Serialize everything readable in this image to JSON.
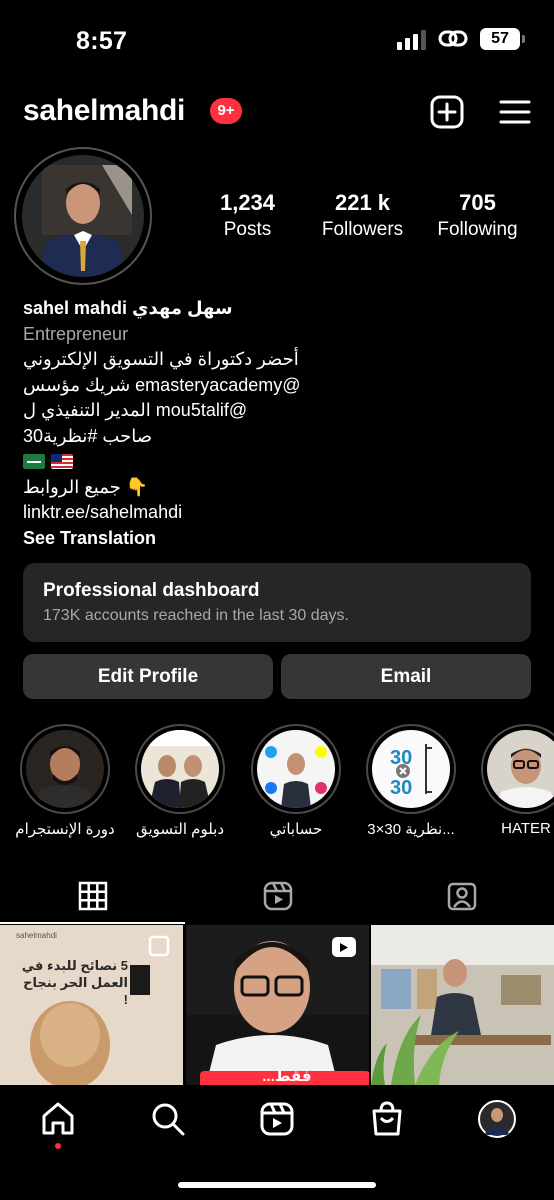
{
  "status_bar": {
    "time": "8:57",
    "battery_level": "57",
    "icons": [
      "signal-icon",
      "link-icon",
      "battery-icon"
    ]
  },
  "header": {
    "username": "sahelmahdi",
    "notification_badge": "9+",
    "icons": [
      "plus-square-icon",
      "hamburger-menu-icon"
    ]
  },
  "stats": [
    {
      "value": "1,234",
      "label": "Posts"
    },
    {
      "value": "221 k",
      "label": "Followers"
    },
    {
      "value": "705",
      "label": "Following"
    }
  ],
  "bio": {
    "name": "sahel mahdi سهل مهدي",
    "category": "Entrepreneur",
    "lines": [
      "أحضر دكتوراة في التسويق الإلكتروني",
      "شريك مؤسس emasteryacademy@",
      "المدير التنفيذي ل mou5talif@",
      "صاحب #نظرية30",
      "جميع الروابط 👇"
    ],
    "link": "linktr.ee/sahelmahdi",
    "see_translation": "See Translation"
  },
  "dashboard": {
    "title": "Professional dashboard",
    "subtitle": "173K accounts reached in the last 30 days."
  },
  "buttons": {
    "edit_profile": "Edit Profile",
    "email": "Email"
  },
  "highlights": [
    {
      "label": "دورة الإنستجرام"
    },
    {
      "label": "دبلوم التسويق"
    },
    {
      "label": "حساباتي"
    },
    {
      "label": "نظرية 30×3..."
    },
    {
      "label": "HATER"
    }
  ],
  "tabs": [
    "grid-icon",
    "reels-icon",
    "tagged-icon"
  ],
  "posts": [
    {
      "overlay_text": "5 نصائح للبدء في العمل الحر بنجاح !",
      "brand": "sahelmahdi"
    },
    {
      "overlay_text": "...فقط"
    },
    {
      "overlay_text": ""
    }
  ],
  "bottom_nav": [
    "home-icon",
    "search-icon",
    "reels-icon",
    "shop-icon",
    "profile-avatar"
  ],
  "colors": {
    "accent_red": "#ff3040",
    "card_bg": "#262626",
    "button_bg": "#363636",
    "muted_text": "#a8a8a8"
  }
}
